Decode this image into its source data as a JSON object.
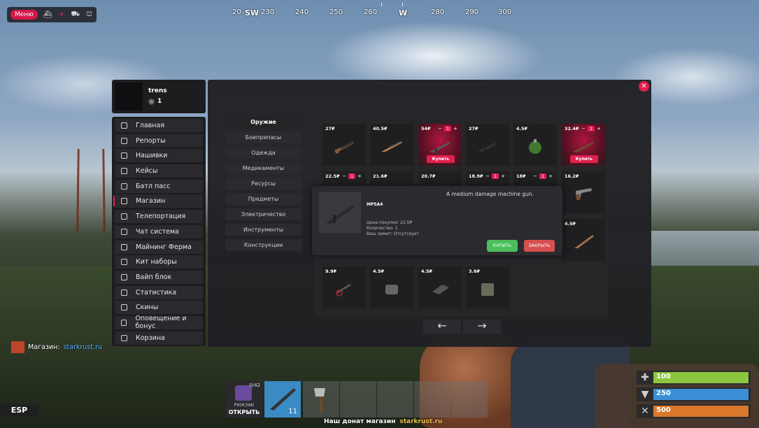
{
  "topmenu": {
    "menu_label": "Меню"
  },
  "compass": {
    "labels": [
      "20",
      "SW",
      "230",
      "240",
      "250",
      "260",
      "W",
      "280",
      "290",
      "300"
    ]
  },
  "profile": {
    "name": "trens",
    "level": "1"
  },
  "sidebar": {
    "items": [
      {
        "label": "Главная"
      },
      {
        "label": "Репорты"
      },
      {
        "label": "Нашивки"
      },
      {
        "label": "Кейсы"
      },
      {
        "label": "Батл пасс"
      },
      {
        "label": "Магазин"
      },
      {
        "label": "Телепортация"
      },
      {
        "label": "Чат система"
      },
      {
        "label": "Майнинг Ферма"
      },
      {
        "label": "Кит наборы"
      },
      {
        "label": "Вайп блок"
      },
      {
        "label": "Статистика"
      },
      {
        "label": "Скины"
      },
      {
        "label": "Оповещение и бонус"
      },
      {
        "label": "Корзина"
      }
    ]
  },
  "categories": [
    "Оружие",
    "Боеприпасы",
    "Одежда",
    "Медикаменты",
    "Ресурсы",
    "Предметы",
    "Электричество",
    "Инструменты",
    "Конструкции"
  ],
  "shop": {
    "buy_label": "Купить",
    "row1": [
      {
        "price": "27₽"
      },
      {
        "price": "40.5₽"
      },
      {
        "price": "54₽",
        "qty": "1"
      },
      {
        "price": "27₽"
      },
      {
        "price": "4.5₽"
      },
      {
        "price": "32.4₽",
        "qty": "1"
      }
    ],
    "row2": [
      {
        "price": "22.5₽",
        "qty": "1"
      },
      {
        "price": "21.6₽"
      },
      {
        "price": "20.7₽"
      },
      {
        "price": "18.9₽",
        "qty": "1"
      },
      {
        "price": "18₽",
        "qty": "1"
      },
      {
        "price": "16.2₽"
      }
    ],
    "row3_last": {
      "price": "4.5₽"
    },
    "row4": [
      {
        "price": "9.9₽"
      },
      {
        "price": "4.5₽"
      },
      {
        "price": "4.5₽"
      },
      {
        "price": "3.6₽"
      }
    ],
    "prev": "←",
    "next": "→"
  },
  "popup": {
    "description": "A medium damage machine gun.",
    "name": "MP5A4",
    "price_line": "Цена покупки: 22.5₽",
    "qty_line": "Количество: 1",
    "limit_line": "Ваш лимит: Отсутсвует",
    "buy": "КУПИТЬ",
    "close": "ЗАКРЫТЬ"
  },
  "chat": {
    "prefix": "Магазин:",
    "link": "starkrust.ru"
  },
  "esp": "ESP",
  "hotbar": {
    "backpack_count": "0/42",
    "backpack_title": "РЮКЗАК",
    "backpack_open": "ОТКРЫТЬ",
    "gun_amount": "11"
  },
  "footer": {
    "text": "Наш донат магазин",
    "link": "starkrust.ru"
  },
  "stats": {
    "health": "100",
    "water": "250",
    "food": "500"
  },
  "colors": {
    "accent": "#e0204f",
    "health": "#8cc63f",
    "water": "#3a8fd4",
    "food": "#d9782b"
  }
}
